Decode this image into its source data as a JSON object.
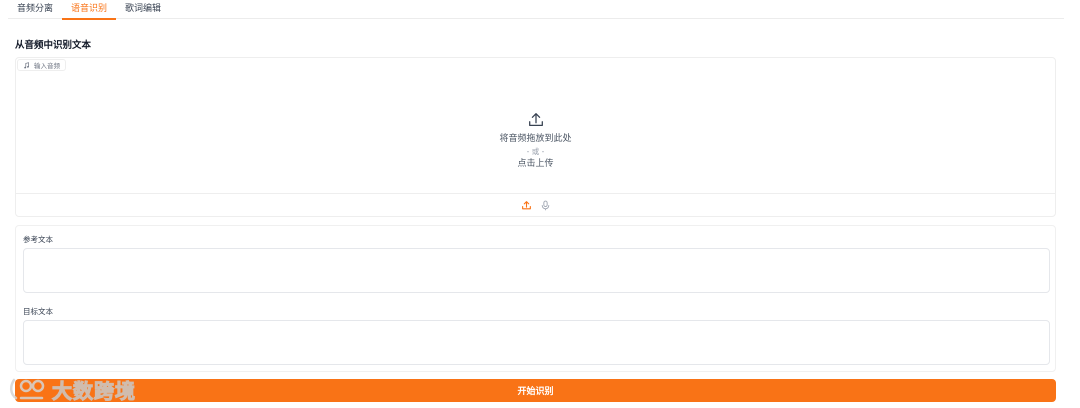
{
  "tabs": [
    {
      "label": "音频分离",
      "active": false
    },
    {
      "label": "语音识别",
      "active": true
    },
    {
      "label": "歌词编辑",
      "active": false
    }
  ],
  "section_title": "从音频中识别文本",
  "audio_input": {
    "label": "输入音频",
    "label_icon": "music-note-icon",
    "drop_text": "将音频拖放到此处",
    "or_text": "- 或 -",
    "click_text": "点击上传",
    "upload_icon": "upload-icon",
    "sources": [
      {
        "icon": "upload-icon",
        "active": true
      },
      {
        "icon": "microphone-icon",
        "active": false
      }
    ]
  },
  "reference_text": {
    "label": "参考文本",
    "value": ""
  },
  "target_text": {
    "label": "目标文本",
    "value": ""
  },
  "start_button": {
    "label": "开始识别"
  },
  "watermark": {
    "text": "大数跨境"
  },
  "colors": {
    "accent": "#f97316",
    "border": "#eeeeee",
    "text": "#374151"
  }
}
